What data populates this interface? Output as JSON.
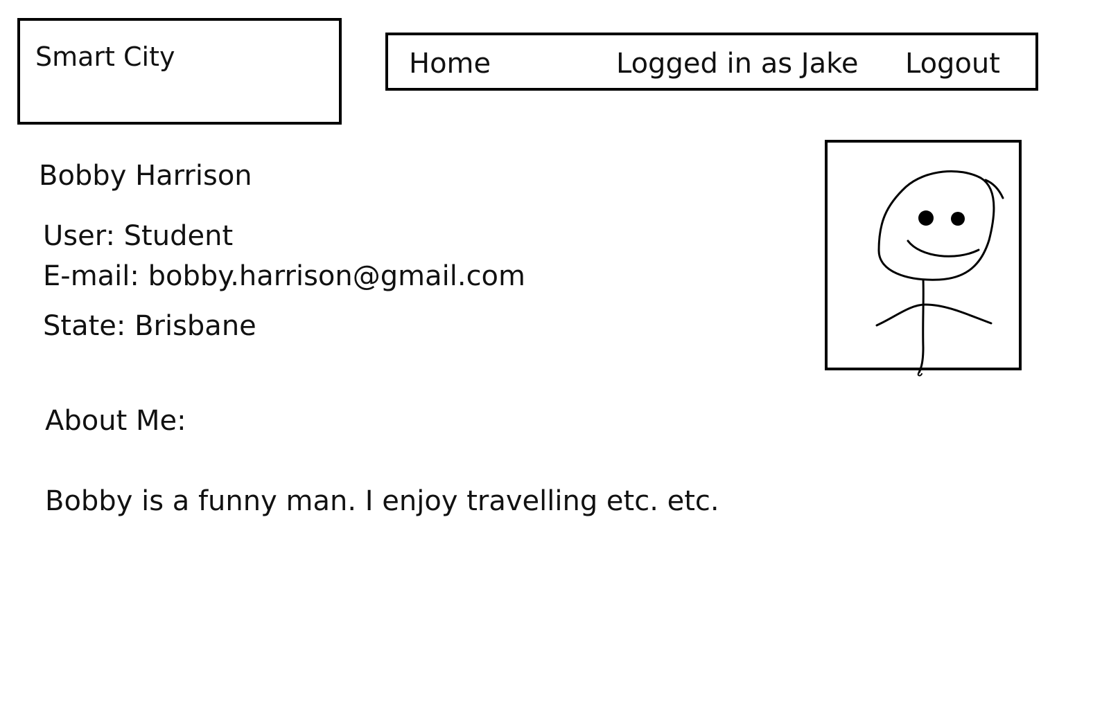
{
  "header": {
    "logo_text": "Smart City"
  },
  "nav": {
    "home_label": "Home",
    "status_label": "Logged in as Jake",
    "logout_label": "Logout"
  },
  "profile": {
    "name": "Bobby Harrison",
    "user_type": "User: Student",
    "email": "E-mail: bobby.harrison@gmail.com",
    "state": "State: Brisbane",
    "avatar_icon": "stick-figure-avatar-icon"
  },
  "about": {
    "heading": "About Me:",
    "text": "Bobby is a funny man. I enjoy travelling etc. etc."
  }
}
